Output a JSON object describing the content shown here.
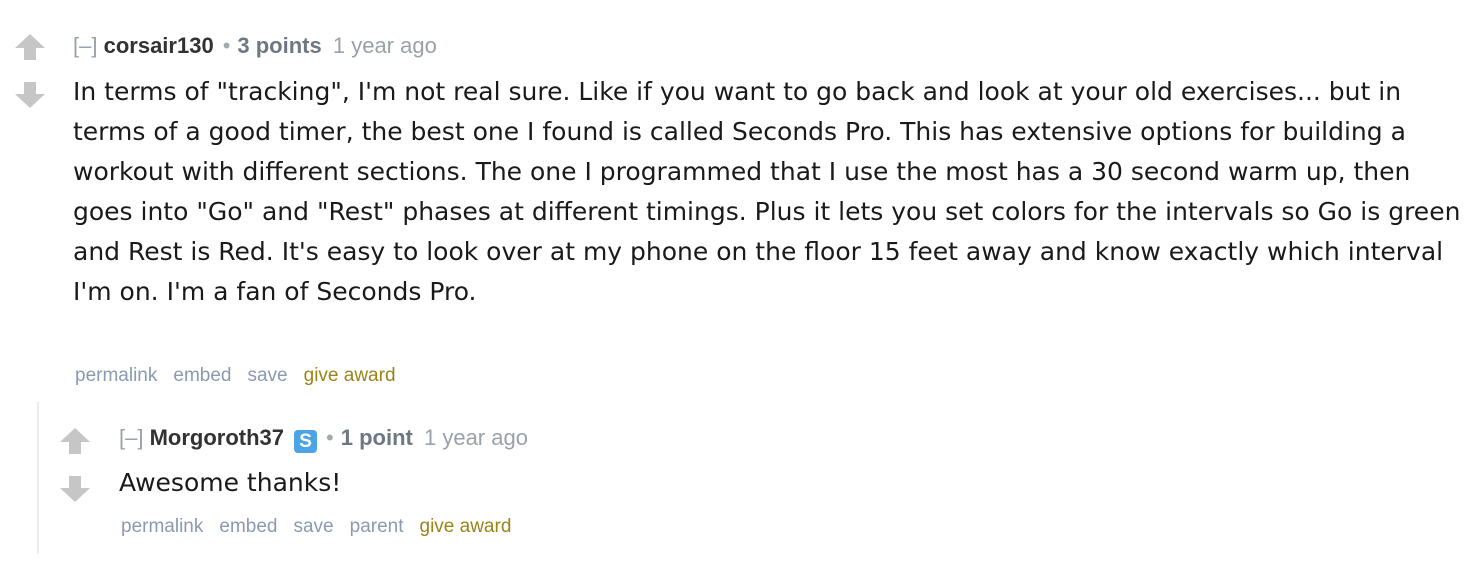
{
  "comments": [
    {
      "collapse": "[–]",
      "author": "corsair130",
      "score": "3 points",
      "time": "1 year ago",
      "body": "In terms of \"tracking\", I'm not real sure. Like if you want to go back and look at your old exercises... but in terms of a good timer, the best one I found is called Seconds Pro. This has extensive options for building a workout with different sections. The one I programmed that I use the most has a 30 second warm up, then goes into \"Go\" and \"Rest\" phases at different timings. Plus it lets you set colors for the intervals so Go is green and Rest is Red. It's easy to look over at my phone on the floor 15 feet away and know exactly which interval I'm on. I'm a fan of Seconds Pro.",
      "buttons": {
        "permalink": "permalink",
        "embed": "embed",
        "save": "save",
        "award": "give award"
      }
    },
    {
      "collapse": "[–]",
      "author": "Morgoroth37",
      "flair": "S",
      "score": "1 point",
      "time": "1 year ago",
      "body": "Awesome thanks!",
      "buttons": {
        "permalink": "permalink",
        "embed": "embed",
        "save": "save",
        "parent": "parent",
        "award": "give award"
      }
    }
  ],
  "colors": {
    "arrow": "#c6c6c6",
    "author": "#323232",
    "score": "#6e7883",
    "muted": "#9aa1ab",
    "button": "#8a9ab0",
    "award": "#9a8419",
    "flair": "#4ca3e6"
  },
  "icons": {
    "upvote": "upvote-arrow-icon",
    "downvote": "downvote-arrow-icon"
  }
}
